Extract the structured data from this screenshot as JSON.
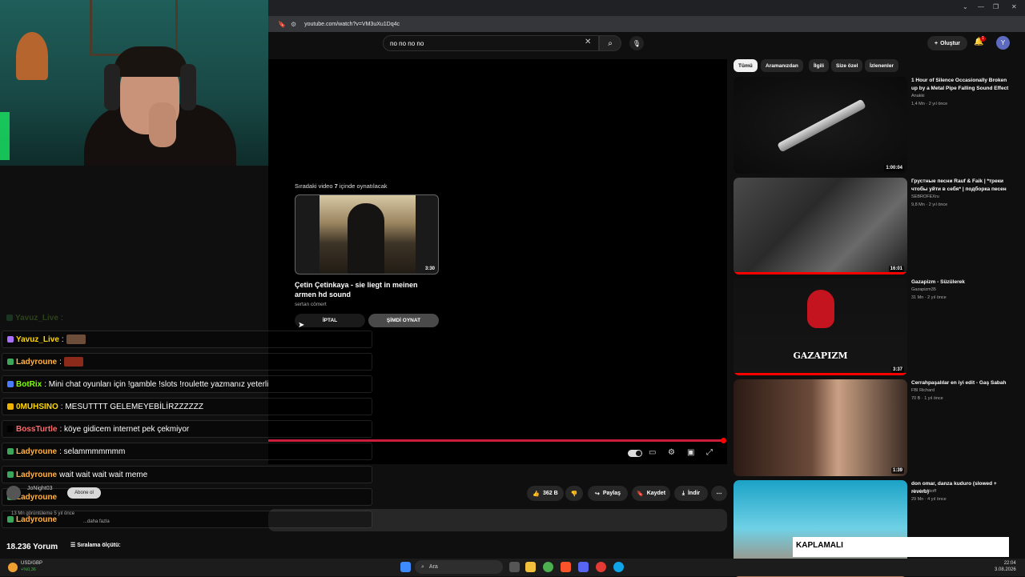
{
  "browser": {
    "url": "youtube.com/watch?v=VM3uXu1Dq4c"
  },
  "header": {
    "search_value": "no no no no",
    "create_label": "Oluştur",
    "bell_count": "1",
    "avatar_letter": "Y"
  },
  "player": {
    "upnext_prefix": "Sıradaki video ",
    "upnext_seconds": "7",
    "upnext_suffix": " içinde oynatılacak",
    "upnext_duration": "3:30",
    "upnext_title": "Çetin Çetinkaya - sie liegt in meinen armen hd sound",
    "upnext_channel": "sertan cömert",
    "cancel_label": "İPTAL",
    "playnow_label": "ŞİMDİ OYNAT"
  },
  "actions": {
    "like_count": "362 B",
    "share_label": "Paylaş",
    "save_label": "Kaydet",
    "download_label": "İndir"
  },
  "channel_overlay": {
    "name": "JoNight03",
    "subscribe_label": "Abone ol",
    "views": "13 Mn görüntüleme  5 yıl önce",
    "more_label": "...daha fazla"
  },
  "comments": {
    "count": "18.236 Yorum",
    "sort_label": "Sıralama ölçütü:"
  },
  "chips": [
    "Tümü",
    "Aramanızdan",
    "İlgili",
    "Size özel",
    "İzlenenler"
  ],
  "recommendations": [
    {
      "title": "1 Hour of Silence Occasionally Broken up by a Metal Pipe Falling Sound Effect",
      "channel": "Anakki",
      "meta": "1,4 Mn · 2 yıl önce",
      "duration": "1:00:04"
    },
    {
      "title": "Грустные песни Rauf & Faik | *треки чтобы уйти в себя* | подборка песен",
      "channel": "SEBROFEXru",
      "meta": "9,8 Mn · 2 yıl önce",
      "duration": "16:01"
    },
    {
      "title": "Gazapizm - Süzülerek",
      "channel": "Gazapizm35",
      "meta": "31 Mn · 2 yıl önce",
      "duration": "3:37",
      "thumb_text": "GAZAPIZM"
    },
    {
      "title": "Cerrahpaşalılar en iyi edit - Gaş Sabah",
      "channel": "FBI Richard",
      "meta": "70 B · 1 yıl önce",
      "duration": "1:39"
    },
    {
      "title": "don omar, danza kuduro (slowed + reverb)",
      "channel": "abcdefuckoff",
      "meta": "29 Mn · 4 yıl önce",
      "duration": ""
    }
  ],
  "chat": [
    {
      "user": "Yavuz_Live",
      "message": ":",
      "color": "#7fd13b",
      "faded": true
    },
    {
      "user": "Yavuz_Live",
      "message": ":",
      "color": "#ffd700"
    },
    {
      "user": "Ladyroune",
      "message": ":",
      "color": "#ffb347"
    },
    {
      "user": "BotRix",
      "message": ": Mini chat oyunları için !gamble !slots !roulette yazmanız yeterli",
      "color": "#7fff00"
    },
    {
      "user": "0MUHSINO",
      "message": ": MESUTTTT GELEMEYEBİLİRZZZZZZ",
      "color": "#ffd700"
    },
    {
      "user": "BossTurtle",
      "message": ": köye gidicem internet pek çekmiyor",
      "color": "#ff6b6b"
    },
    {
      "user": "Ladyroune",
      "message": ": selammmmmmm",
      "color": "#ffb347"
    },
    {
      "user": "Ladyroune",
      "message": "wait wait wait wait meme",
      "color": "#ffb347"
    },
    {
      "user": "Ladyroune",
      "message": "",
      "color": "#ffb347"
    },
    {
      "user": "Ladyroune",
      "message": "",
      "color": "#ffb347"
    }
  ],
  "overlay": {
    "text": "KAPLAMALI"
  },
  "taskbar": {
    "ticker_name": "USD/GBP",
    "ticker_value": "+%0,36",
    "search_placeholder": "Ara",
    "time": "22:04",
    "date": "3.08.2026"
  },
  "colors": {
    "accent": "#ff0000",
    "background": "#0f0f0f"
  }
}
